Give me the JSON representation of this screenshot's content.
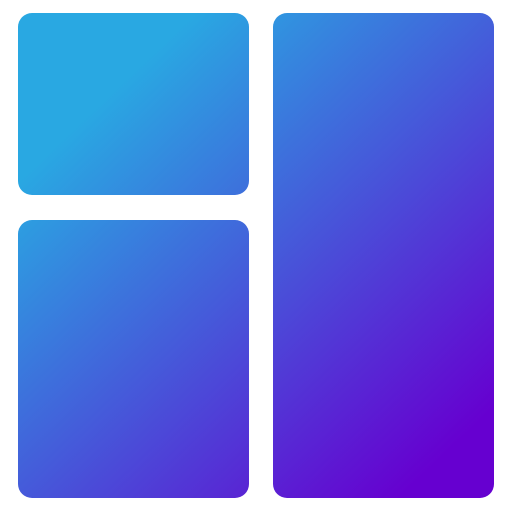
{
  "icon": {
    "name": "dashboard-layout-icon",
    "gradient": {
      "start_color": "#29A8E2",
      "end_color": "#6600D0"
    },
    "tiles": [
      {
        "name": "top-left-tile"
      },
      {
        "name": "bottom-left-tile"
      },
      {
        "name": "right-tall-tile"
      }
    ]
  }
}
